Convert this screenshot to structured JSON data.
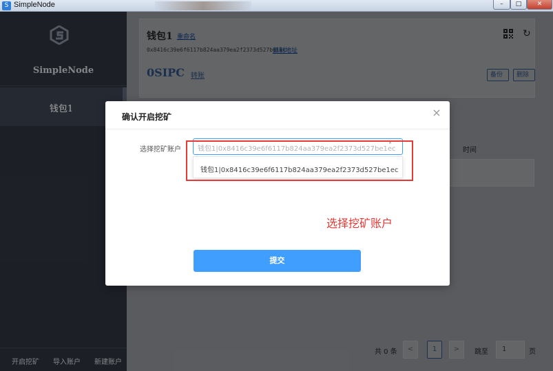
{
  "window": {
    "title": "SimpleNode",
    "icon": "app-logo-icon",
    "controls": {
      "minimize": "–",
      "maximize": "□",
      "close": "✕"
    }
  },
  "sidebar": {
    "brand": "SimpleNode",
    "items": [
      {
        "label": "钱包1",
        "active": true
      }
    ],
    "bottom": {
      "start_mining": "开启挖矿",
      "import_account": "导入账户",
      "new_account": "新建账户"
    }
  },
  "wallet": {
    "name": "钱包1",
    "rename_link": "重命名",
    "address": "0x8416c39e6f6117b824aa379ea2f2373d527be1ec",
    "copy_link": "复制地址",
    "balance": "0SIPC",
    "transfer_link": "转账",
    "backup_label": "备份",
    "delete_label": "删除",
    "qr_icon": "qr-code-icon",
    "refresh_icon": "refresh-icon"
  },
  "table": {
    "time_header": "时间"
  },
  "pager": {
    "total": "共 0 条",
    "prev": "<",
    "current_page": "1",
    "next": ">",
    "goto_label": "跳至",
    "goto_value": "1",
    "page_unit": "页"
  },
  "dialog": {
    "title": "确认开启挖矿",
    "close": "×",
    "field_label": "选择挖矿账户",
    "select_placeholder": "钱包1|0x8416c39e6f6117b824aa379ea2f2373d527be1ec",
    "chevron": "˄",
    "options": [
      "钱包1|0x8416c39e6f6117b824aa379ea2f2373d527be1ec"
    ],
    "submit_label": "提交"
  },
  "annotation": {
    "text": "选择挖矿账户",
    "color": "#e53935"
  }
}
